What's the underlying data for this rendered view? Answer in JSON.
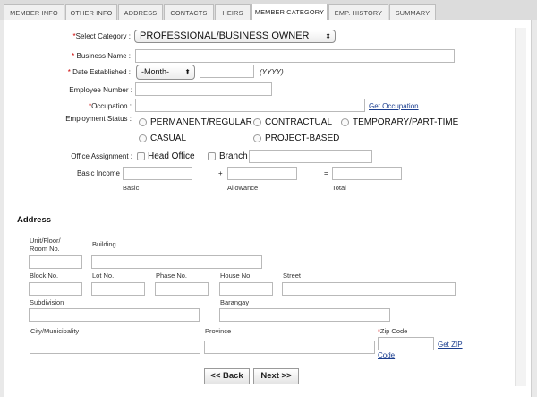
{
  "tabs": [
    "MEMBER INFO",
    "OTHER INFO",
    "ADDRESS",
    "CONTACTS",
    "HEIRS",
    "MEMBER CATEGORY",
    "EMP. HISTORY",
    "SUMMARY"
  ],
  "form": {
    "select_category_label": "Select Category :",
    "select_category_value": "PROFESSIONAL/BUSINESS OWNER",
    "business_name_label": "Business Name :",
    "date_established_label": "Date Established :",
    "month_value": "-Month-",
    "year_hint": "(YYYY)",
    "employee_number_label": "Employee Number :",
    "occupation_label": "Occupation :",
    "get_occupation_link": "Get Occupation",
    "employment_status_label": "Employment Status :",
    "status_options": [
      "PERMANENT/REGULAR",
      "CONTRACTUAL",
      "TEMPORARY/PART-TIME",
      "CASUAL",
      "PROJECT-BASED"
    ],
    "office_assignment_label": "Office Assignment :",
    "head_office_label": "Head Office",
    "branch_label": "Branch",
    "basic_income_label": "Basic Income",
    "plus_sign": "+",
    "equals_sign": "=",
    "basic_caption": "Basic",
    "allowance_caption": "Allowance",
    "total_caption": "Total"
  },
  "address": {
    "heading": "Address",
    "unit_label_1": "Unit/Floor/",
    "unit_label_2": "Room No.",
    "building_label": "Building",
    "block_label": "Block No.",
    "lot_label": "Lot No.",
    "phase_label": "Phase No.",
    "house_label": "House No.",
    "street_label": "Street",
    "subdivision_label": "Subdivision",
    "barangay_label": "Barangay",
    "city_label": "City/Municipality",
    "province_label": "Province",
    "zip_label": "Zip Code",
    "get_zip_1": "Get ZIP",
    "get_zip_2": "Code"
  },
  "buttons": {
    "back": "<< Back",
    "next": "Next >>"
  },
  "colors": {
    "required": "#cc0000",
    "link": "#1a3d8f"
  }
}
